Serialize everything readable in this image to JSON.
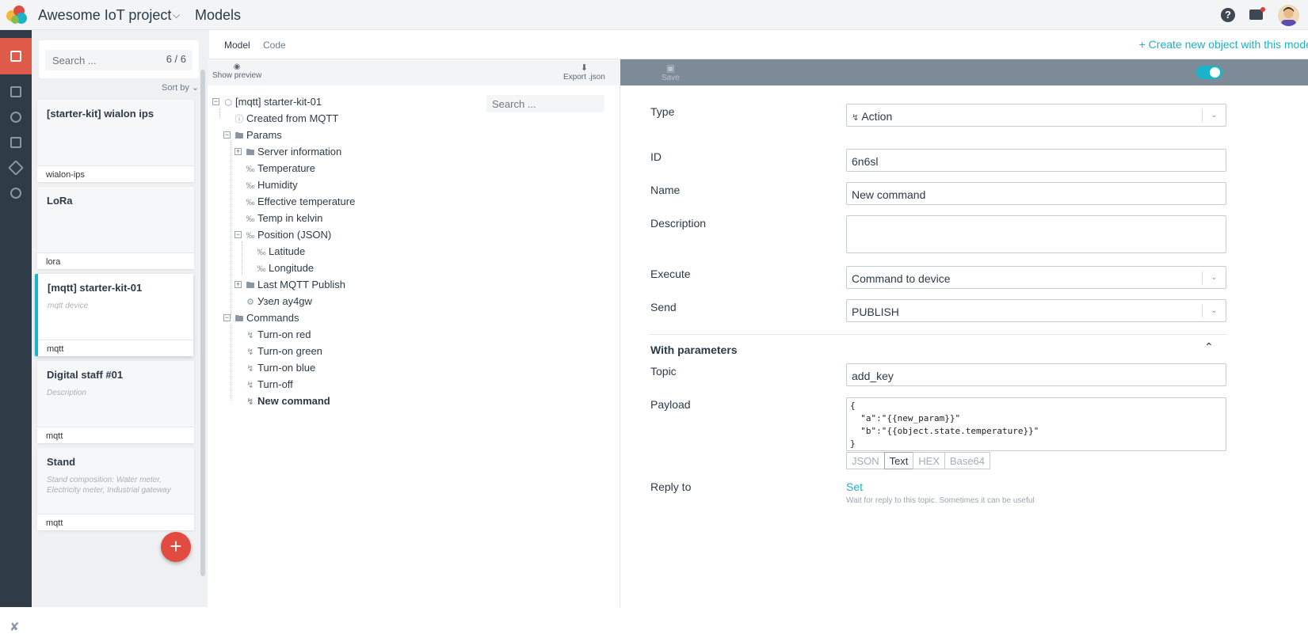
{
  "header": {
    "project": "Awesome IoT project",
    "section": "Models",
    "help_label": "?"
  },
  "sidebar": {
    "search_placeholder": "Search ...",
    "count": "6 / 6",
    "sort_label": "Sort by",
    "cards": [
      {
        "title": "[starter-kit] wialon ips",
        "description": "",
        "type": "wialon-ips"
      },
      {
        "title": "LoRa",
        "description": "",
        "type": "lora"
      },
      {
        "title": "[mqtt] starter-kit-01",
        "description": "mqtt device",
        "type": "mqtt"
      },
      {
        "title": "Digital staff #01",
        "description": "Description",
        "type": "mqtt"
      },
      {
        "title": "Stand",
        "description": "Stand composition: Water meter, Electricity meter, Industrial gateway",
        "type": "mqtt"
      }
    ],
    "fab_label": "+"
  },
  "tabs": {
    "model": "Model",
    "code": "Code",
    "create_link": "+ Create new object with this model"
  },
  "tree": {
    "show_preview": "Show preview",
    "export": "Export .json",
    "search_placeholder": "Search ...",
    "nodes": {
      "root": "[mqtt] starter-kit-01",
      "created": "Created from MQTT",
      "params": "Params",
      "server_info": "Server information",
      "temperature": "Temperature",
      "humidity": "Humidity",
      "eff_temp": "Effective temperature",
      "temp_kelvin": "Temp in kelvin",
      "position": "Position (JSON)",
      "latitude": "Latitude",
      "longitude": "Longitude",
      "last_publish": "Last MQTT Publish",
      "uzel": "Узел ay4gw",
      "commands": "Commands",
      "turn_red": "Turn-on red",
      "turn_green": "Turn-on green",
      "turn_blue": "Turn-on blue",
      "turn_off": "Turn-off",
      "new_command": "New command"
    }
  },
  "editor": {
    "save_label": "Save",
    "labels": {
      "type": "Type",
      "id": "ID",
      "name": "Name",
      "description": "Description",
      "execute": "Execute",
      "send": "Send",
      "with_params": "With parameters",
      "topic": "Topic",
      "payload": "Payload",
      "reply_to": "Reply to"
    },
    "values": {
      "type": "Action",
      "id": "6n6sl",
      "name": "New command",
      "description": "",
      "execute": "Command to device",
      "send": "PUBLISH",
      "topic": "add_key",
      "payload": "{\n  \"a\":\"{{new_param}}\"\n  \"b\":\"{{object.state.temperature}}\"\n}"
    },
    "formats": [
      "JSON",
      "Text",
      "HEX",
      "Base64"
    ],
    "active_format": "Text",
    "reply_set": "Set",
    "reply_hint": "Wait for reply to this topic. Sometimes it can be useful",
    "enabled": true
  },
  "colors": {
    "accent": "#1ab3c7",
    "nav_bg": "#2f3b47",
    "nav_active": "#e05a4a",
    "fab": "#e24b3f"
  }
}
